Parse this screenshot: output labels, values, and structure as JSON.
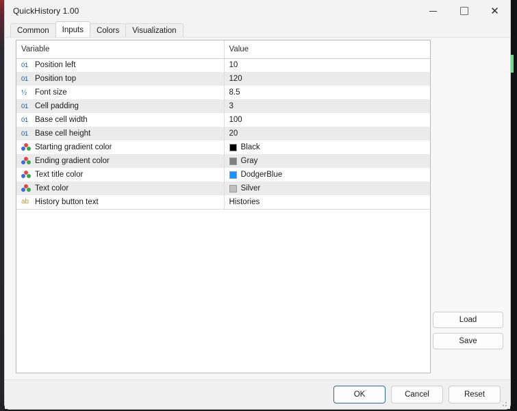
{
  "window": {
    "title": "QuickHistory 1.00",
    "controls": {
      "minimize": "minimize",
      "maximize": "maximize",
      "close": "close"
    }
  },
  "tabs": [
    {
      "label": "Common",
      "active": false
    },
    {
      "label": "Inputs",
      "active": true
    },
    {
      "label": "Colors",
      "active": false
    },
    {
      "label": "Visualization",
      "active": false
    }
  ],
  "table": {
    "headers": {
      "variable": "Variable",
      "value": "Value"
    },
    "rows": [
      {
        "icon": "integer-icon",
        "variable": "Position left",
        "value": "10",
        "swatch": null
      },
      {
        "icon": "integer-icon",
        "variable": "Position top",
        "value": "120",
        "swatch": null
      },
      {
        "icon": "double-icon",
        "variable": "Font size",
        "value": "8.5",
        "swatch": null
      },
      {
        "icon": "integer-icon",
        "variable": "Cell padding",
        "value": "3",
        "swatch": null
      },
      {
        "icon": "integer-icon",
        "variable": "Base cell width",
        "value": "100",
        "swatch": null
      },
      {
        "icon": "integer-icon",
        "variable": "Base cell height",
        "value": "20",
        "swatch": null
      },
      {
        "icon": "color-icon",
        "variable": "Starting gradient color",
        "value": "Black",
        "swatch": "#000000"
      },
      {
        "icon": "color-icon",
        "variable": "Ending gradient color",
        "value": "Gray",
        "swatch": "#808080"
      },
      {
        "icon": "color-icon",
        "variable": "Text title color",
        "value": "DodgerBlue",
        "swatch": "#1E90FF"
      },
      {
        "icon": "color-icon",
        "variable": "Text color",
        "value": "Silver",
        "swatch": "#C0C0C0"
      },
      {
        "icon": "string-icon",
        "variable": "History button text",
        "value": "Histories",
        "swatch": null
      }
    ]
  },
  "side_buttons": {
    "load": "Load",
    "save": "Save"
  },
  "footer_buttons": {
    "ok": "OK",
    "cancel": "Cancel",
    "reset": "Reset"
  },
  "icon_glyphs": {
    "integer-icon": "01",
    "double-icon": "½",
    "string-icon": "ab"
  },
  "colors": {
    "accent_focus": "#2b6a9c",
    "type_numeric": "#15519c",
    "type_string": "#c8951f",
    "row_alt": "#ebebeb"
  }
}
